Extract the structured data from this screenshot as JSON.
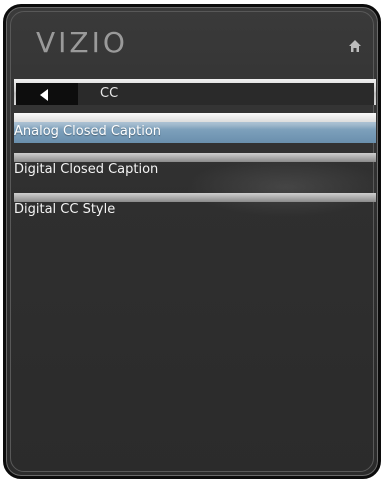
{
  "header": {
    "logo_text": "VIZIO",
    "home_icon": "home-icon"
  },
  "nav": {
    "back_icon": "back-arrow-icon",
    "title": "CC"
  },
  "menu": {
    "items": [
      {
        "label": "Analog Closed Caption",
        "selected": true
      },
      {
        "label": "Digital Closed Caption",
        "selected": false
      },
      {
        "label": "Digital CC Style",
        "selected": false
      }
    ]
  },
  "colors": {
    "panel_bg": "#2f2f2f",
    "selection": "#7da0bb",
    "text": "#f4f4f4"
  }
}
